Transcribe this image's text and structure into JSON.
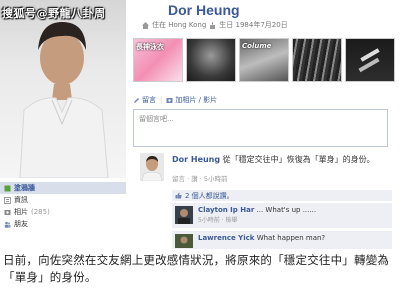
{
  "watermark": "搜狐号@野龍八卦周",
  "profile": {
    "name": "Dor Heung",
    "location": "住在 Hong Kong",
    "birthday": "生日 1984年7月20日"
  },
  "photo_strip": [
    {
      "caption": "長神泳衣"
    },
    {
      "caption": ""
    },
    {
      "caption": "Colume"
    },
    {
      "caption": ""
    },
    {
      "caption": ""
    }
  ],
  "publisher": {
    "tab_status": "留言",
    "tab_photo": "加相片 / 影片",
    "placeholder": "留個言吧..."
  },
  "left_nav": [
    {
      "label": "塗鴉牆",
      "count": ""
    },
    {
      "label": "資訊",
      "count": ""
    },
    {
      "label": "相片",
      "count": "(285)"
    },
    {
      "label": "朋友",
      "count": ""
    }
  ],
  "story": {
    "author": "Dor Heung",
    "text": "從「穩定交往中」恢復為「單身」的身份。",
    "meta": "留言 · 讚 · 5小時前"
  },
  "likes": "2 個人都說讚。",
  "comments": [
    {
      "author": "Clayton Ip Har",
      "text": "... What's up ......",
      "meta": "5小時前 · 檢舉"
    },
    {
      "author": "Lawrence Yick",
      "text": "What happen man?",
      "meta": ""
    }
  ],
  "caption": "日前，向佐突然在交友網上更改感情狀況，將原來的「穩定交往中」轉變為「單身」的身份。",
  "colors": {
    "facebook_blue": "#3b5998",
    "nav_active": "#d8dfea",
    "comment_bg": "#edeff4"
  }
}
